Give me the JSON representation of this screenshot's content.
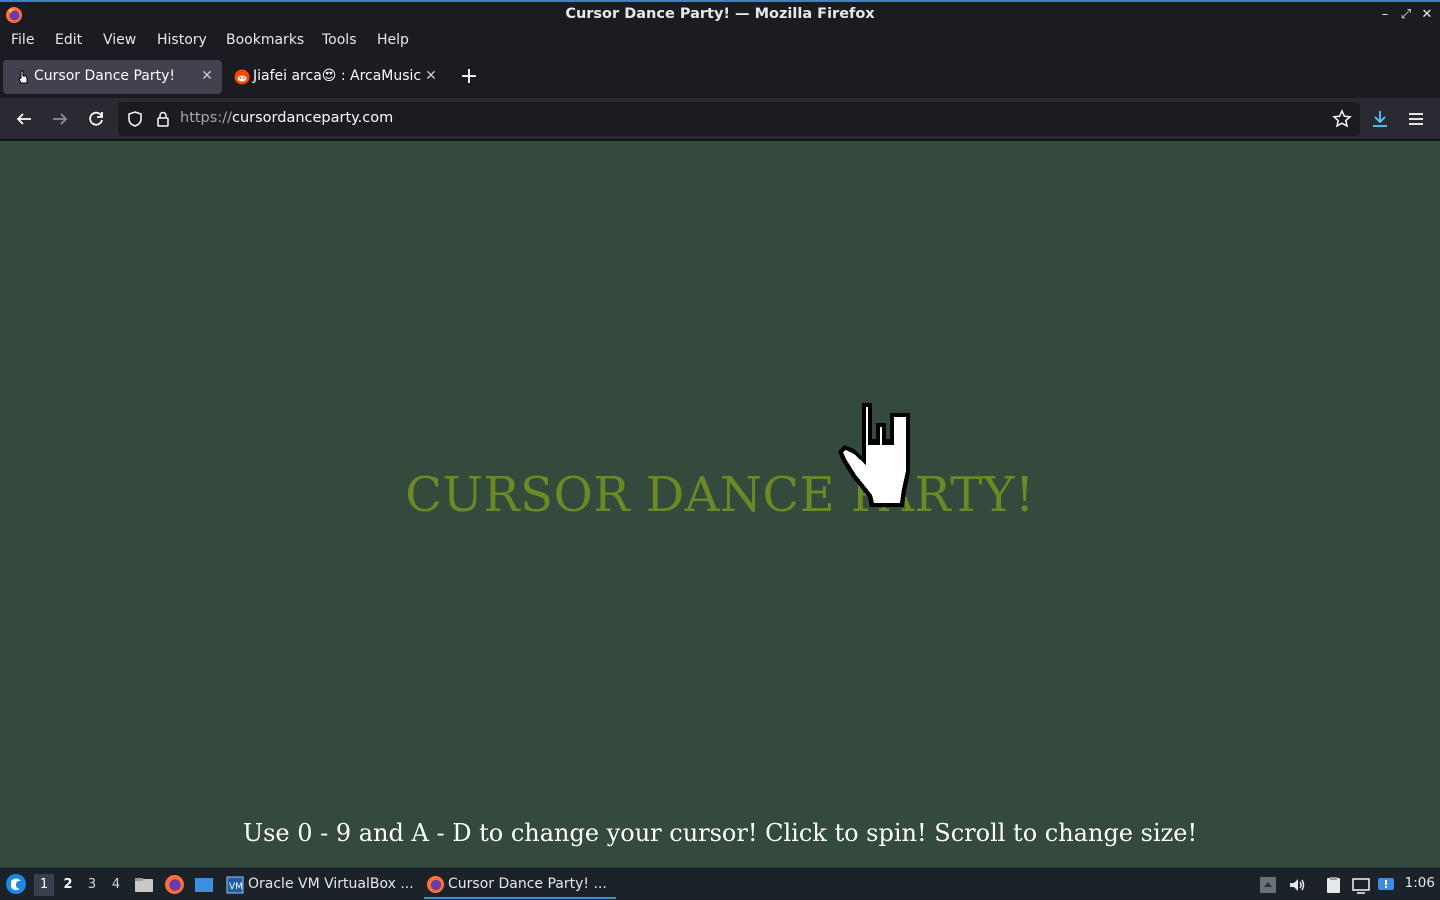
{
  "window": {
    "title": "Cursor Dance Party! — Mozilla Firefox"
  },
  "menu": {
    "file": "File",
    "edit": "Edit",
    "view": "View",
    "history": "History",
    "bookmarks": "Bookmarks",
    "tools": "Tools",
    "help": "Help"
  },
  "tabs": [
    {
      "label": "Cursor Dance Party!",
      "active": true
    },
    {
      "label": "Jiafei arca😍 : ArcaMusic",
      "active": false
    }
  ],
  "url": {
    "scheme": "https://",
    "host": "cursordanceparty.com"
  },
  "page": {
    "title": "CURSOR DANCE PARTY!",
    "instructions": "Use 0 - 9 and A - D to change your cursor! Click to spin! Scroll to change size!",
    "title_color": "#6b8a26",
    "background_color": "#334a3c"
  },
  "taskbar": {
    "workspaces": [
      "1",
      "2",
      "3",
      "4"
    ],
    "tasks": [
      {
        "label": "Oracle VM VirtualBox ...",
        "icon": "virtualbox-icon"
      },
      {
        "label": "Cursor Dance Party! ...",
        "icon": "firefox-icon"
      }
    ],
    "clock": "1:06"
  }
}
